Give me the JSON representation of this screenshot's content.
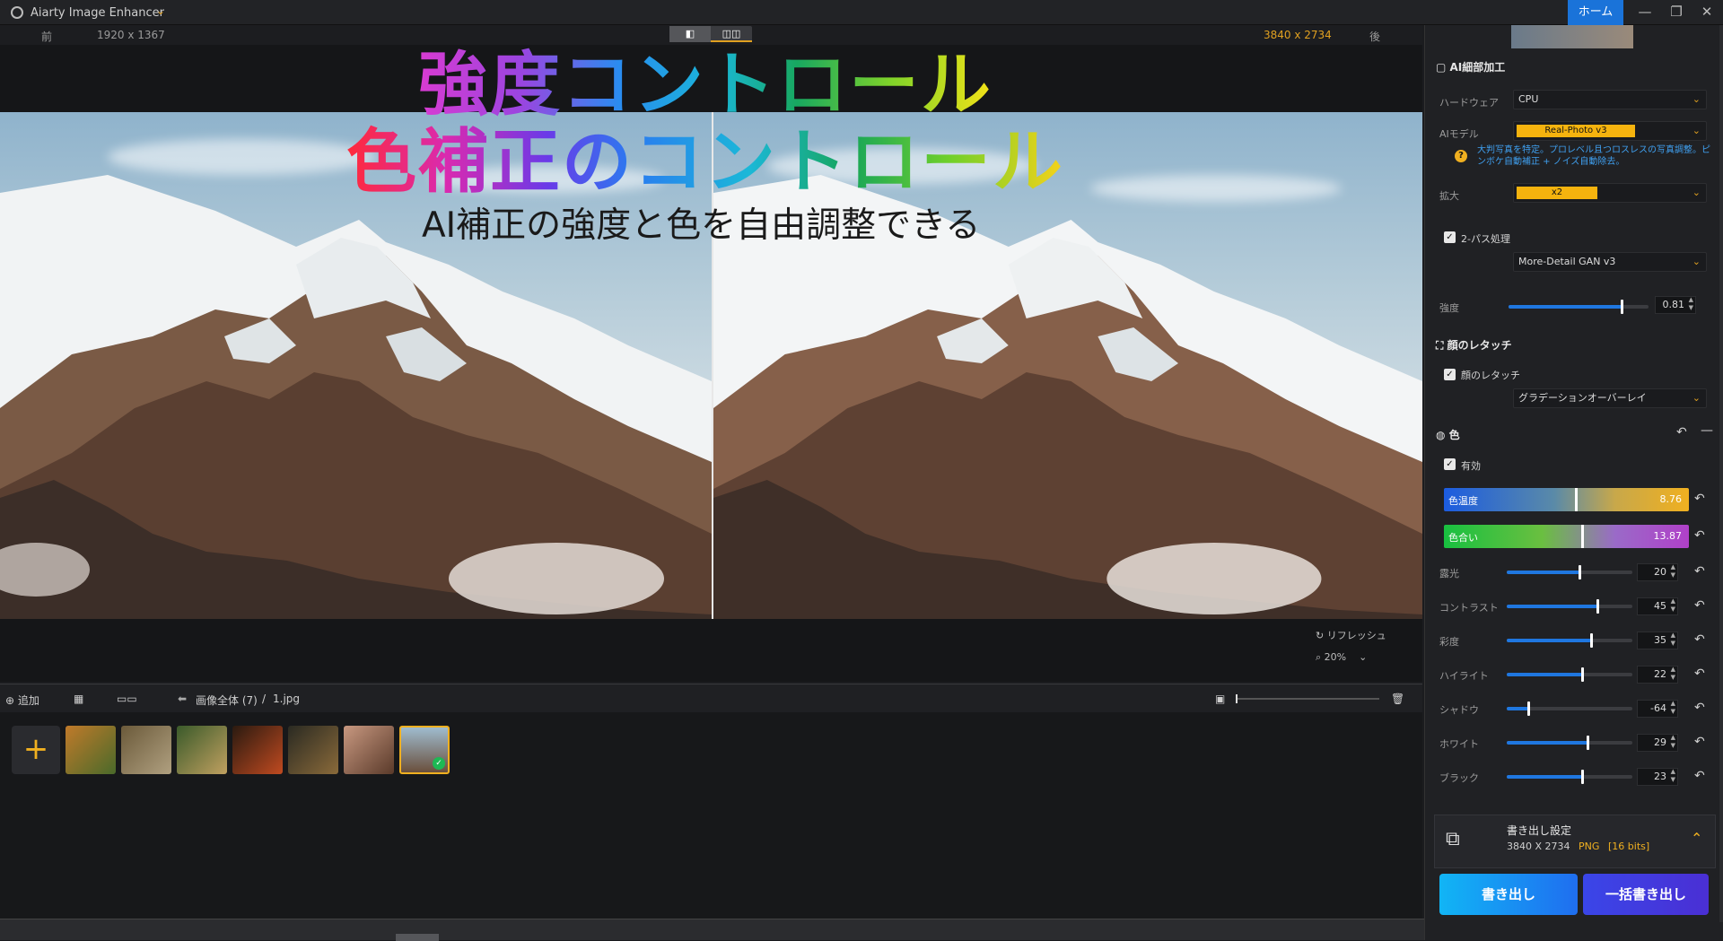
{
  "titlebar": {
    "app_title": "Aiarty Image Enhancer",
    "home": "ホーム",
    "minimize": "—",
    "maximize": "❐",
    "close": "✕"
  },
  "canvas": {
    "before_label": "前",
    "before_res": "1920 x 1367",
    "after_res": "3840 x 2734",
    "after_label": "後",
    "overlay_line1": "強度コントロール",
    "overlay_line2": "色補正のコントロール",
    "overlay_line3": "AI補正の強度と色を自由調整できる",
    "refresh": "リフレッシュ",
    "zoom": "20%"
  },
  "bottombar": {
    "add": "追加",
    "breadcrumb_all": "画像全体 (7)",
    "sep": "/",
    "file": "1.jpg"
  },
  "thumbnails": {
    "count": 7,
    "selected_index": 6
  },
  "panel": {
    "ai_section": "AI細部加工",
    "hardware_label": "ハードウェア",
    "hardware_value": "CPU",
    "model_label": "AIモデル",
    "model_value": "Real-Photo  v3",
    "model_desc": "大判写真を特定。プロレベル且つロスレスの写真調整。ピンボケ自動補正 + ノイズ自動除去。",
    "scale_label": "拡大",
    "scale_value": "x2",
    "twopass_label": "2-パス処理",
    "twopass_value": "More-Detail GAN  v3",
    "strength_label": "強度",
    "strength_value": "0.81",
    "face_section": "顔のレタッチ",
    "face_label": "顔のレタッチ",
    "face_value": "グラデーションオーバーレイ",
    "color_section": "色",
    "enable_label": "有効",
    "temp_label": "色温度",
    "temp_value": "8.76",
    "tint_label": "色合い",
    "tint_value": "13.87",
    "sliders": [
      {
        "label": "露光",
        "value": "20",
        "level": 0.58
      },
      {
        "label": "コントラスト",
        "value": "45",
        "level": 0.72
      },
      {
        "label": "彩度",
        "value": "35",
        "level": 0.67
      },
      {
        "label": "ハイライト",
        "value": "22",
        "level": 0.6
      },
      {
        "label": "シャドウ",
        "value": "-64",
        "level": 0.17
      },
      {
        "label": "ホワイト",
        "value": "29",
        "level": 0.64
      },
      {
        "label": "ブラック",
        "value": "23",
        "level": 0.6
      }
    ],
    "strength_level": 0.81,
    "export_title": "書き出し設定",
    "export_res": "3840 X 2734",
    "export_fmt": "PNG",
    "export_bits": "[16 bits]",
    "export_btn": "書き出し",
    "batch_btn": "一括書き出し"
  },
  "colors": {
    "accent": "#f0b020",
    "blue": "#1f77e0"
  }
}
